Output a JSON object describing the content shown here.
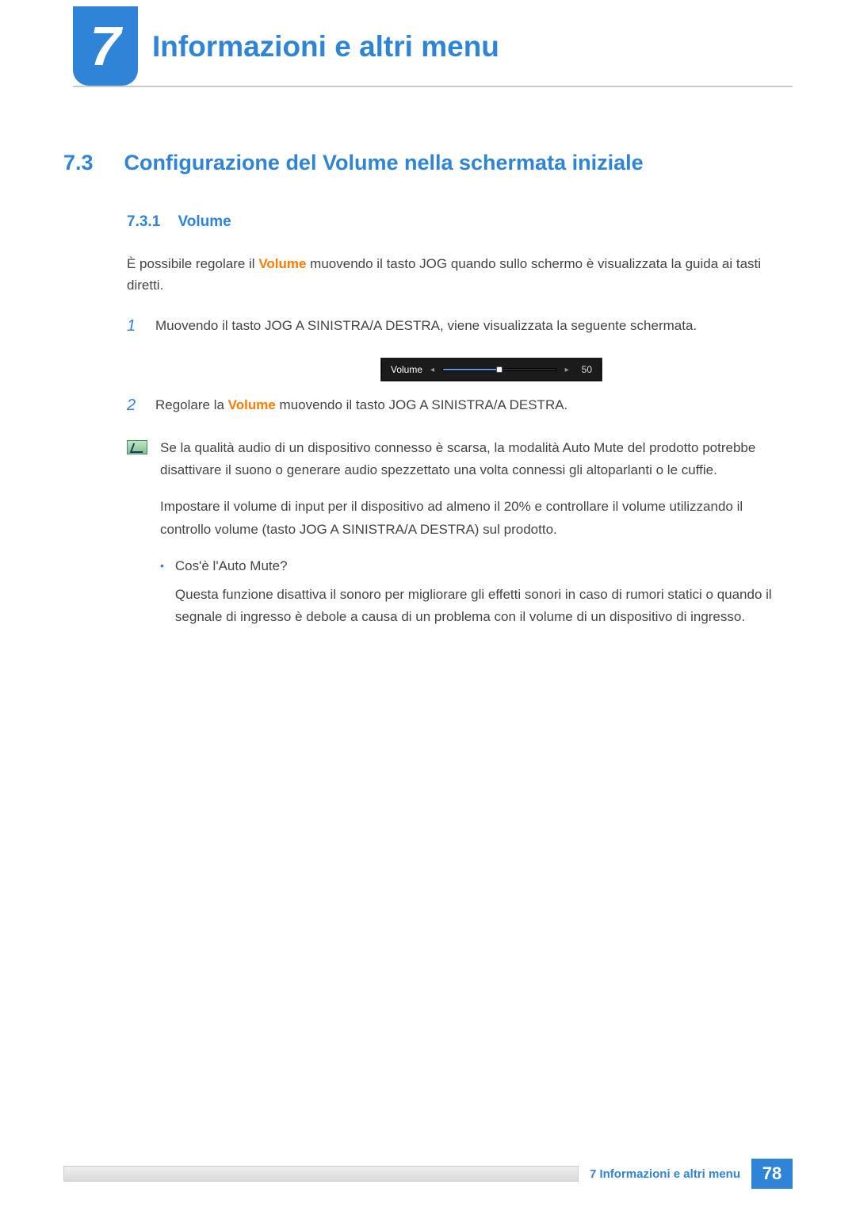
{
  "chapter": {
    "number": "7",
    "title": "Informazioni e altri menu"
  },
  "section": {
    "number": "7.3",
    "title": "Configurazione del Volume nella schermata iniziale"
  },
  "subsection": {
    "number": "7.3.1",
    "title": "Volume"
  },
  "intro": {
    "pre": "È possibile regolare il ",
    "keyword": "Volume",
    "post": " muovendo il tasto JOG quando sullo schermo è visualizzata la guida ai tasti diretti."
  },
  "steps": [
    {
      "n": "1",
      "text": "Muovendo il tasto JOG A SINISTRA/A DESTRA, viene visualizzata la seguente schermata."
    },
    {
      "n": "2",
      "pre": "Regolare la ",
      "keyword": "Volume",
      "post": " muovendo il tasto JOG A SINISTRA/A DESTRA."
    }
  ],
  "osd": {
    "label": "Volume",
    "value": "50"
  },
  "note": {
    "p1": "Se la qualità audio di un dispositivo connesso è scarsa, la modalità Auto Mute del prodotto potrebbe disattivare il suono o generare audio spezzettato una volta connessi gli altoparlanti o le cuffie.",
    "p2": "Impostare il volume di input per il dispositivo ad almeno il 20% e controllare il volume utilizzando il controllo volume (tasto JOG A SINISTRA/A DESTRA) sul prodotto.",
    "bullet": {
      "q": "Cos'è l'Auto Mute?",
      "a": "Questa funzione disattiva il sonoro per migliorare gli effetti sonori in caso di rumori statici o quando il segnale di ingresso è debole a causa di un problema con il volume di un dispositivo di ingresso."
    }
  },
  "footer": {
    "text": "7 Informazioni e altri menu",
    "page": "78"
  }
}
